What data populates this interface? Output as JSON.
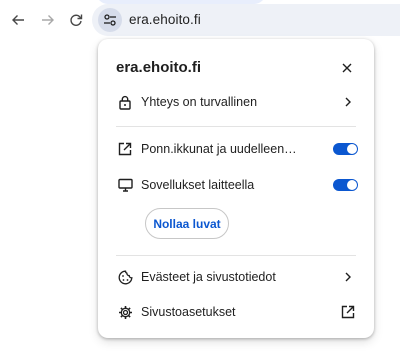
{
  "toolbar": {
    "back_icon": "arrow-left-icon",
    "forward_icon": "arrow-right-icon",
    "reload_icon": "reload-icon",
    "site_info_icon": "tune-icon",
    "url": "era.ehoito.fi"
  },
  "popup": {
    "title": "era.ehoito.fi",
    "close_icon": "close-icon",
    "connection": {
      "label": "Yhteys on turvallinen",
      "icon": "lock-icon",
      "trailing_icon": "chevron-right-icon"
    },
    "permissions": [
      {
        "label": "Ponn.ikkunat ja uudelleen…",
        "icon": "open-in-new-icon",
        "enabled": true
      },
      {
        "label": "Sovellukset laitteella",
        "icon": "monitor-icon",
        "enabled": true
      }
    ],
    "reset_label": "Nollaa luvat",
    "cookies": {
      "label": "Evästeet ja sivustotiedot",
      "icon": "cookie-icon",
      "trailing_icon": "chevron-right-icon"
    },
    "site_settings": {
      "label": "Sivustoasetukset",
      "icon": "gear-icon",
      "trailing_icon": "external-link-icon"
    }
  },
  "colors": {
    "accent": "#0b57d0",
    "text": "#1f1f1f",
    "omnibox_bg": "#eef1f7"
  }
}
